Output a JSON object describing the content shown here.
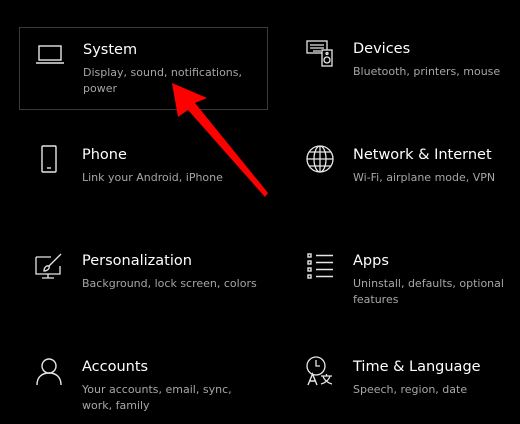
{
  "accent_color": "#ff0000",
  "tiles": [
    {
      "icon": "laptop-icon",
      "title": "System",
      "description": "Display, sound, notifications, power",
      "selected": true
    },
    {
      "icon": "keyboard-speaker-icon",
      "title": "Devices",
      "description": "Bluetooth, printers, mouse",
      "selected": false
    },
    {
      "icon": "phone-icon",
      "title": "Phone",
      "description": "Link your Android, iPhone",
      "selected": false
    },
    {
      "icon": "globe-icon",
      "title": "Network & Internet",
      "description": "Wi-Fi, airplane mode, VPN",
      "selected": false
    },
    {
      "icon": "paintbrush-icon",
      "title": "Personalization",
      "description": "Background, lock screen, colors",
      "selected": false
    },
    {
      "icon": "apps-list-icon",
      "title": "Apps",
      "description": "Uninstall, defaults, optional features",
      "selected": false
    },
    {
      "icon": "person-icon",
      "title": "Accounts",
      "description": "Your accounts, email, sync, work, family",
      "selected": false
    },
    {
      "icon": "time-language-icon",
      "title": "Time & Language",
      "description": "Speech, region, date",
      "selected": false
    }
  ]
}
